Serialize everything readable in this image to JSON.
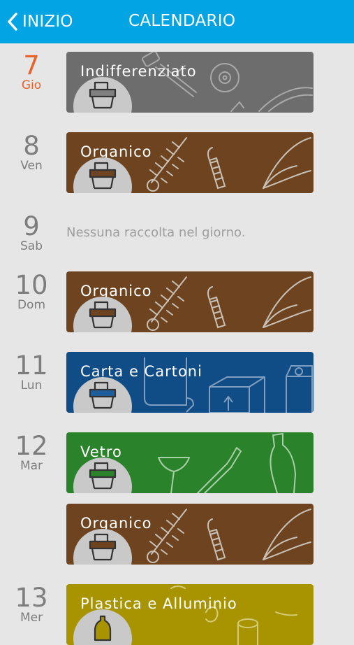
{
  "header": {
    "back_label": "INIZIO",
    "title": "CALENDARIO"
  },
  "days": [
    {
      "num": "7",
      "dow": "Gio"
    },
    {
      "num": "8",
      "dow": "Ven"
    },
    {
      "num": "9",
      "dow": "Sab"
    },
    {
      "num": "10",
      "dow": "Dom"
    },
    {
      "num": "11",
      "dow": "Lun"
    },
    {
      "num": "12",
      "dow": "Mar"
    },
    {
      "num": "13",
      "dow": "Mer"
    }
  ],
  "cards": [
    {
      "label": "Indifferenziato",
      "color": "#6d6d6d"
    },
    {
      "label": "Organico",
      "color": "#6e4420"
    },
    {
      "label": "Organico",
      "color": "#6e4420"
    },
    {
      "label": "Carta e Cartoni",
      "color": "#104d86"
    },
    {
      "label": "Vetro",
      "color": "#2a822a"
    },
    {
      "label": "Organico",
      "color": "#6e4420"
    },
    {
      "label": "Plastica e Alluminio",
      "color": "#a89400"
    }
  ],
  "no_collection_text": "Nessuna raccolta nel giorno.",
  "today_color": "#e8622a",
  "accent": "#02a4e3"
}
